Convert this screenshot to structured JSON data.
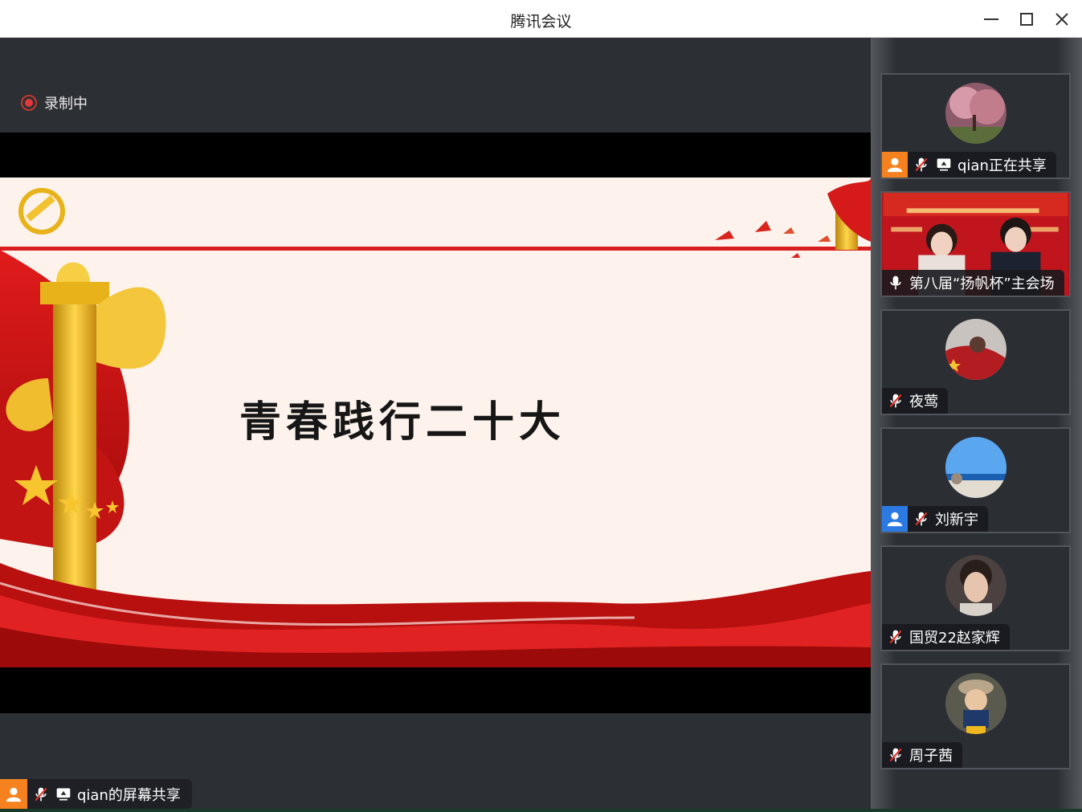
{
  "window": {
    "title": "腾讯会议"
  },
  "recording": {
    "label": "录制中",
    "color": "#e03a3a"
  },
  "slide": {
    "title": "青春践行二十大"
  },
  "screen_share": {
    "label": "qian的屏幕共享",
    "avatar_color": "#f5821f"
  },
  "participants": [
    {
      "name": "qian正在共享",
      "avatar_chip_color": "#f5821f",
      "muted": true,
      "sharing": true
    },
    {
      "name": "第八届“扬帆杯”主会场",
      "muted": false,
      "video": true
    },
    {
      "name": "夜莺",
      "muted": true
    },
    {
      "name": "刘新宇",
      "avatar_chip_color": "#2a7ae2",
      "muted": true
    },
    {
      "name": "国贸22赵家辉",
      "muted": true
    },
    {
      "name": "周子茜",
      "muted": true
    }
  ]
}
